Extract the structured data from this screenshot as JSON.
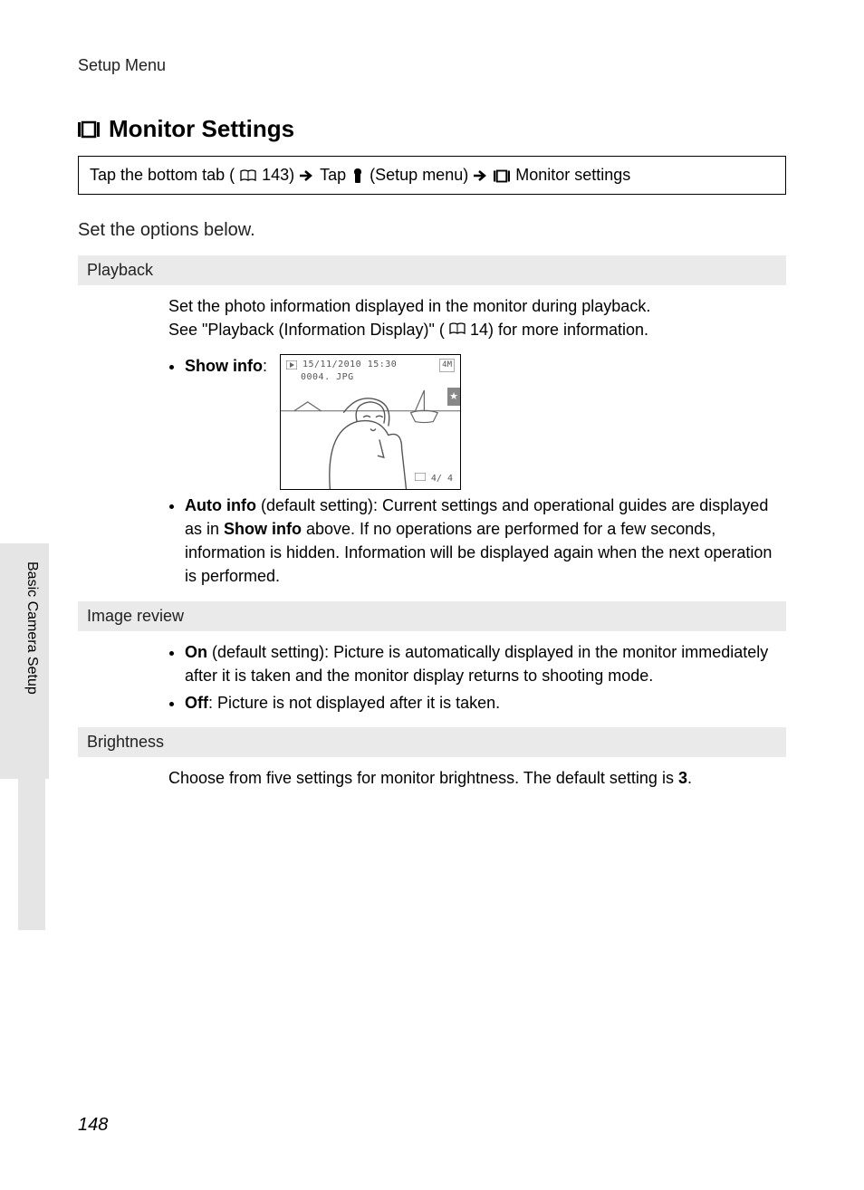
{
  "breadcrumb": "Setup Menu",
  "title": "Monitor Settings",
  "nav": {
    "part1": "Tap the bottom tab (",
    "ref1": "143) ",
    "part2": "Tap ",
    "part3": "(Setup menu) ",
    "part4": "Monitor settings"
  },
  "intro": "Set the options below.",
  "sections": {
    "playback": {
      "header": "Playback",
      "desc1": "Set the photo information displayed in the monitor during playback.",
      "desc2a": "See \"Playback (Information Display)\" (",
      "desc2b": "14) for more information.",
      "showInfoLabel": "Show info",
      "example": {
        "date": "15/11/2010 15:30",
        "file": "0004. JPG",
        "counter": "4/   4",
        "size": "4M"
      },
      "autoInfo": {
        "label": "Auto info",
        "text": " (default setting): Current settings and operational guides are displayed as in ",
        "label2": "Show info",
        "text2": " above. If no operations are performed for a few seconds, information is hidden. Information will be displayed again when the next operation is performed."
      }
    },
    "imageReview": {
      "header": "Image review",
      "on": {
        "label": "On",
        "text": " (default setting): Picture is automatically displayed in the monitor immediately after it is taken and the monitor display returns to shooting mode."
      },
      "off": {
        "label": "Off",
        "text": ": Picture is not displayed after it is taken."
      }
    },
    "brightness": {
      "header": "Brightness",
      "text1": "Choose from five settings for monitor brightness. The default setting is ",
      "value": "3",
      "text2": "."
    }
  },
  "sideTab": "Basic Camera Setup",
  "pageNumber": "148"
}
